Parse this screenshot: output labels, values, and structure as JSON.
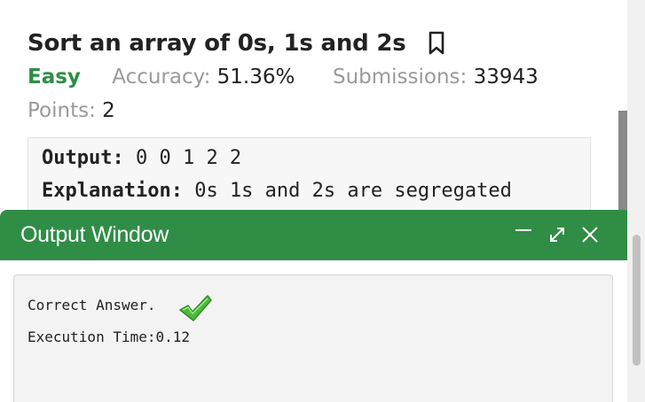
{
  "problem": {
    "title": "Sort an array of 0s, 1s and 2s",
    "difficulty": "Easy",
    "accuracy_label": "Accuracy:",
    "accuracy_value": "51.36%",
    "submissions_label": "Submissions:",
    "submissions_value": "33943",
    "points_label": "Points:",
    "points_value": "2",
    "difficulty_color": "#2f8d46"
  },
  "example": {
    "output_label": "Output:",
    "output_value": "0 0 1 2 2",
    "explanation_label": "Explanation:",
    "explanation_value": "0s 1s and 2s are segregated"
  },
  "output_window": {
    "title": "Output Window",
    "result_text": "Correct Answer.",
    "execution_time": "Execution Time:0.12",
    "header_color": "#2f8d46",
    "icons": [
      "minimize-icon",
      "expand-icon",
      "close-icon",
      "checkmark-icon",
      "bookmark-icon"
    ]
  }
}
